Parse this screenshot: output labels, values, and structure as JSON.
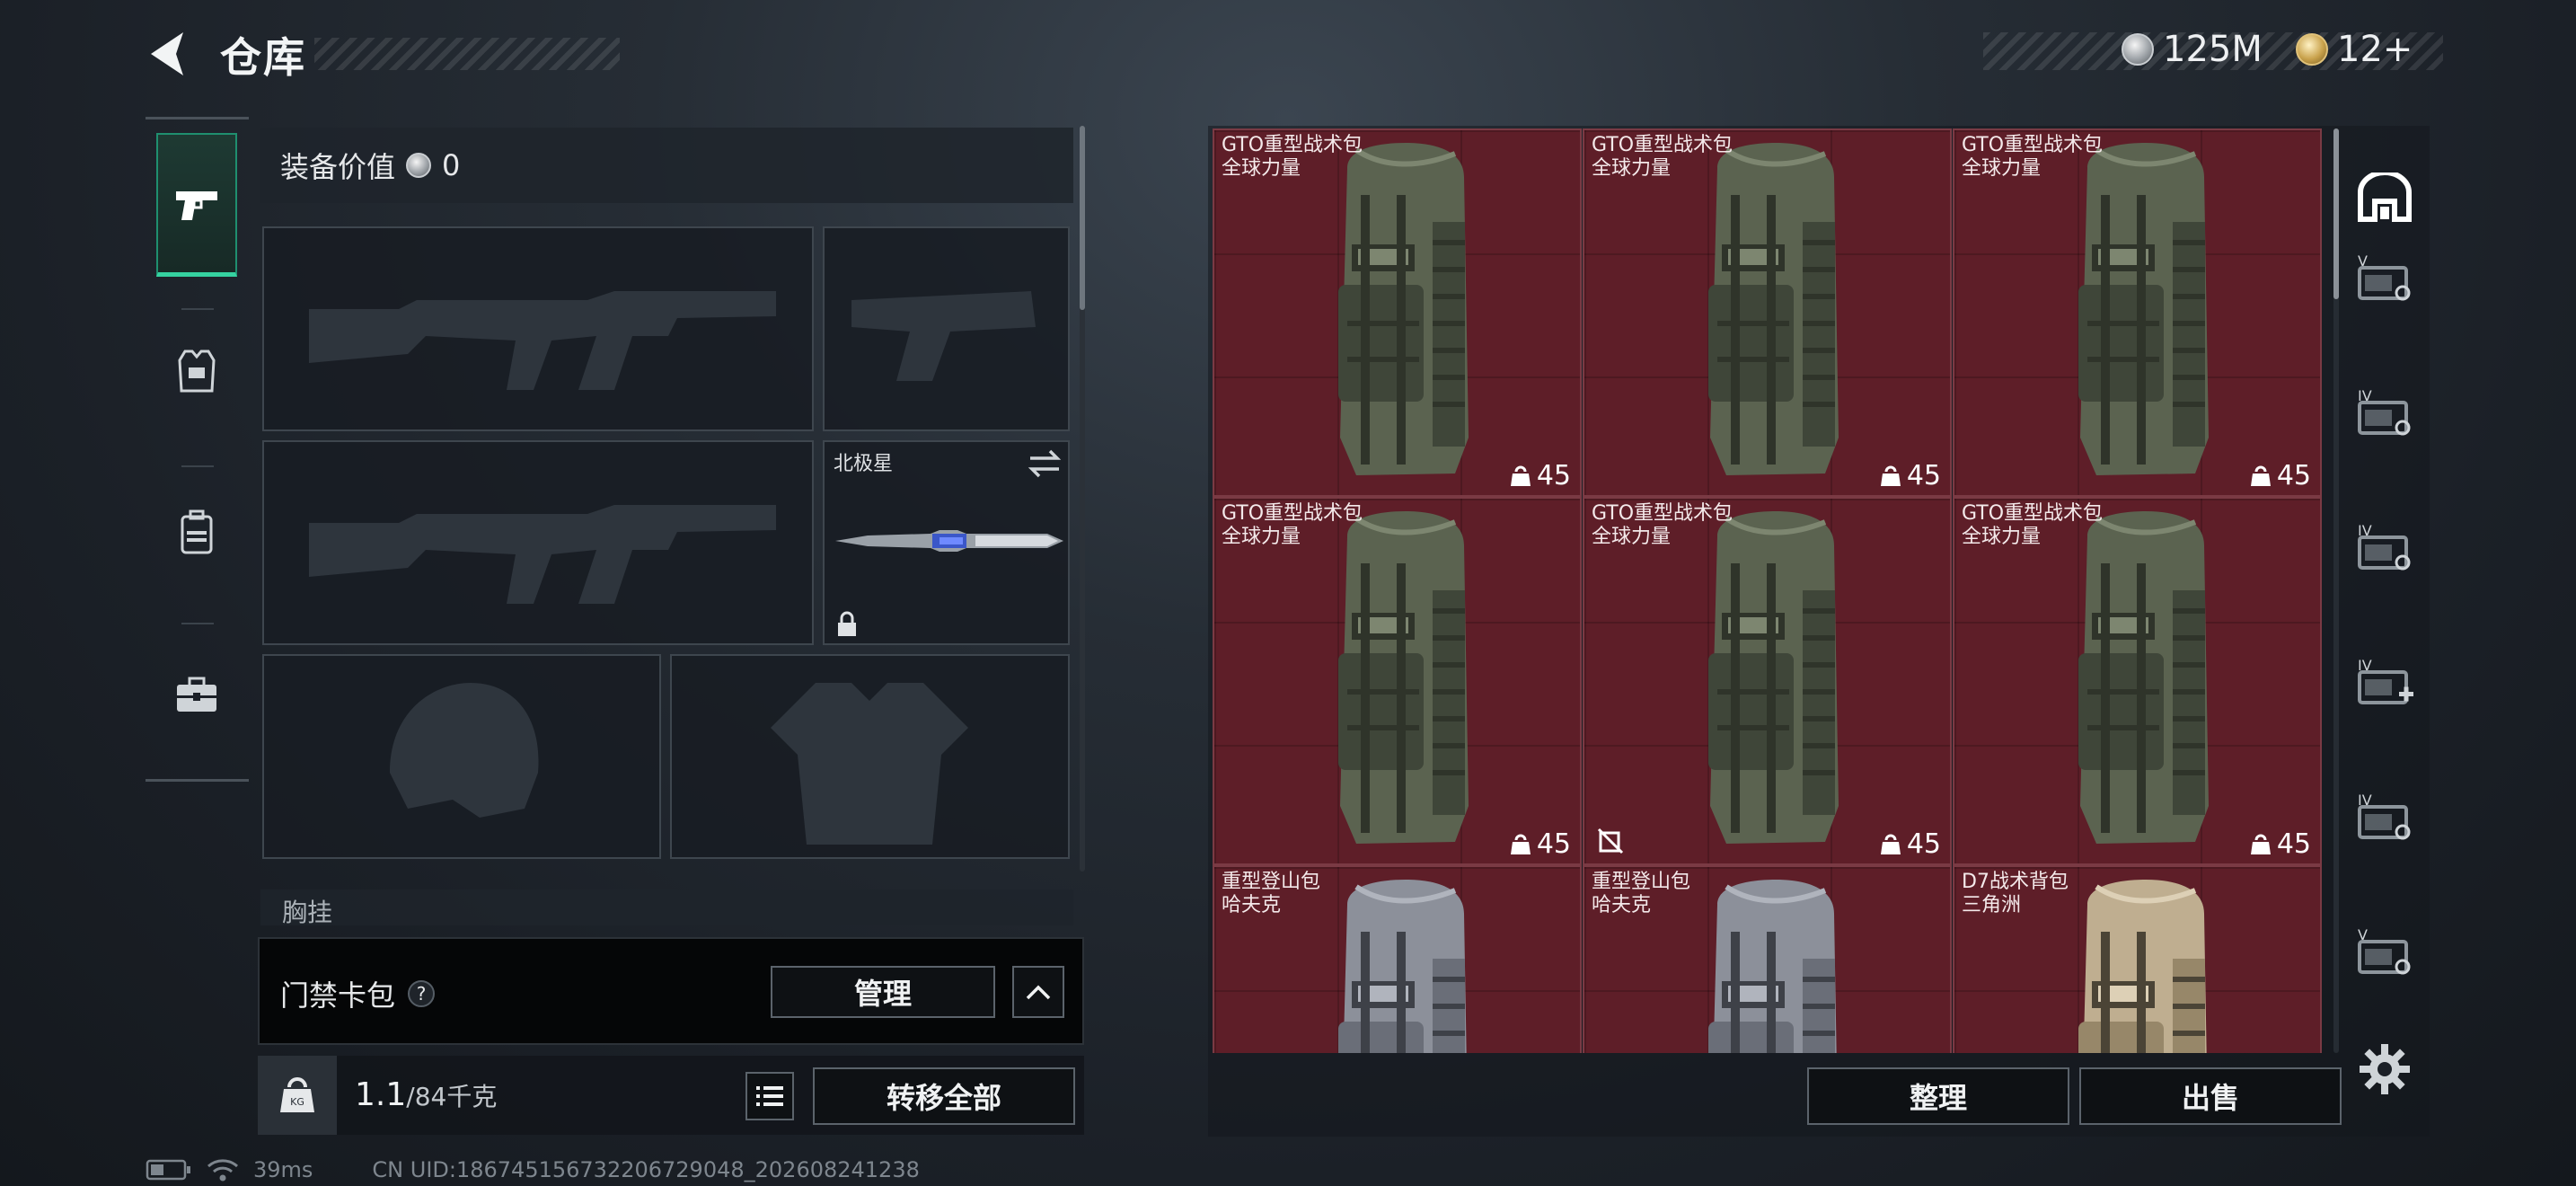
{
  "header": {
    "title": "仓库",
    "back_icon": "back-chevron-icon"
  },
  "currency": [
    {
      "icon": "silver-coin-icon",
      "value": "125M"
    },
    {
      "icon": "gold-coin-icon",
      "value": "12+"
    }
  ],
  "left_nav": {
    "items": [
      {
        "icon": "pistol-icon",
        "active": true
      },
      {
        "icon": "armor-vest-icon",
        "active": false
      },
      {
        "icon": "backpack-icon",
        "active": false
      },
      {
        "icon": "briefcase-icon",
        "active": false
      }
    ]
  },
  "loadout": {
    "equip_value_label": "装备价值",
    "equip_value": "0",
    "melee_slot_label": "北极星",
    "next_section_label": "胸挂",
    "keycard_label": "门禁卡包",
    "keycard_help": "?",
    "manage_label": "管理",
    "weight_value": "1.1",
    "weight_max": "/84千克",
    "transfer_all_label": "转移全部"
  },
  "stash": {
    "items": [
      {
        "name": "GTO重型战术包",
        "sub": "全球力量",
        "count": "45",
        "color": "green"
      },
      {
        "name": "GTO重型战术包",
        "sub": "全球力量",
        "count": "45",
        "color": "green"
      },
      {
        "name": "GTO重型战术包",
        "sub": "全球力量",
        "count": "45",
        "color": "green"
      },
      {
        "name": "GTO重型战术包",
        "sub": "全球力量",
        "count": "45",
        "color": "green"
      },
      {
        "name": "GTO重型战术包",
        "sub": "全球力量",
        "count": "45",
        "color": "green",
        "flag": "no-trade-icon"
      },
      {
        "name": "GTO重型战术包",
        "sub": "全球力量",
        "count": "45",
        "color": "green"
      },
      {
        "name": "重型登山包",
        "sub": "哈夫克",
        "count": "",
        "color": "grey"
      },
      {
        "name": "重型登山包",
        "sub": "哈夫克",
        "count": "",
        "color": "grey"
      },
      {
        "name": "D7战术背包",
        "sub": "三角洲",
        "count": "",
        "color": "tan"
      }
    ],
    "sort_label": "整理",
    "sell_label": "出售"
  },
  "right_tabs": [
    {
      "icon": "stash-home-icon",
      "label": ""
    },
    {
      "icon": "storage-box-icon",
      "label": "V"
    },
    {
      "icon": "storage-box-icon",
      "label": "IV"
    },
    {
      "icon": "storage-box-icon",
      "label": "IV"
    },
    {
      "icon": "medical-box-icon",
      "label": "IV"
    },
    {
      "icon": "storage-box-icon",
      "label": "IV"
    },
    {
      "icon": "storage-box-icon",
      "label": "V"
    }
  ],
  "status_bar": {
    "ping": "39ms",
    "uid": "CN UID:186745156732206729048_202608241238"
  },
  "colors": {
    "accent": "#35d2a0",
    "cell_bg": "#5e1e28",
    "panel_bg": "#181d23"
  }
}
